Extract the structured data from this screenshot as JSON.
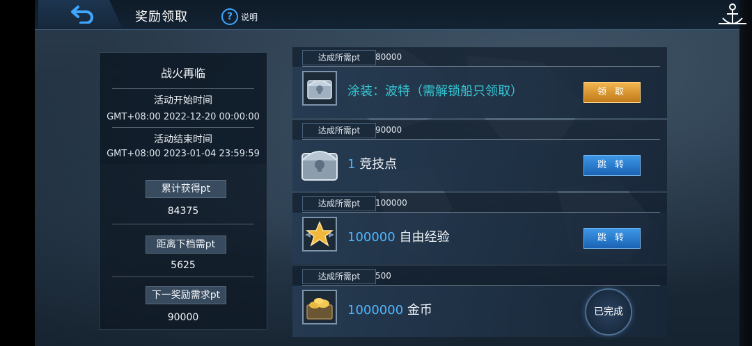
{
  "header": {
    "title": "奖励领取",
    "help_icon": "?",
    "help_label": "说明"
  },
  "info": {
    "event_name": "战火再临",
    "start_label": "活动开始时间",
    "start_time": "GMT+08:00 2022-12-20 00:00:00",
    "end_label": "活动结束时间",
    "end_time": "GMT+08:00 2023-01-04 23:59:59",
    "total_label": "累计获得pt",
    "total_value": "84375",
    "distance_label": "距离下档需pt",
    "distance_value": "5625",
    "next_label": "下一奖励需求pt",
    "next_value": "90000"
  },
  "rewards": [
    {
      "req_label": "达成所需pt",
      "req_value": "80000",
      "icon": "silver-chest-icon",
      "reward_prefix": "",
      "reward_main": "涂装：波特（需解锁船只领取）",
      "action_label": "领 取",
      "action_type": "claim"
    },
    {
      "req_label": "达成所需pt",
      "req_value": "90000",
      "icon": "large-silver-chest-icon",
      "reward_prefix": "1",
      "reward_main": "竞技点",
      "action_label": "跳 转",
      "action_type": "jump"
    },
    {
      "req_label": "达成所需pt",
      "req_value": "100000",
      "icon": "gold-star-icon",
      "reward_prefix": "100000",
      "reward_main": "自由经验",
      "action_label": "跳 转",
      "action_type": "jump"
    },
    {
      "req_label": "达成所需pt",
      "req_value": "500",
      "icon": "gold-coins-icon",
      "reward_prefix": "1000000",
      "reward_main": "金币",
      "action_label": "已完成",
      "action_type": "completed"
    }
  ],
  "colors": {
    "accent_blue": "#3fa7ff",
    "cyan_text": "#35c6d3",
    "claim_gold": "#f2b54e",
    "jump_blue": "#3d97e6"
  }
}
